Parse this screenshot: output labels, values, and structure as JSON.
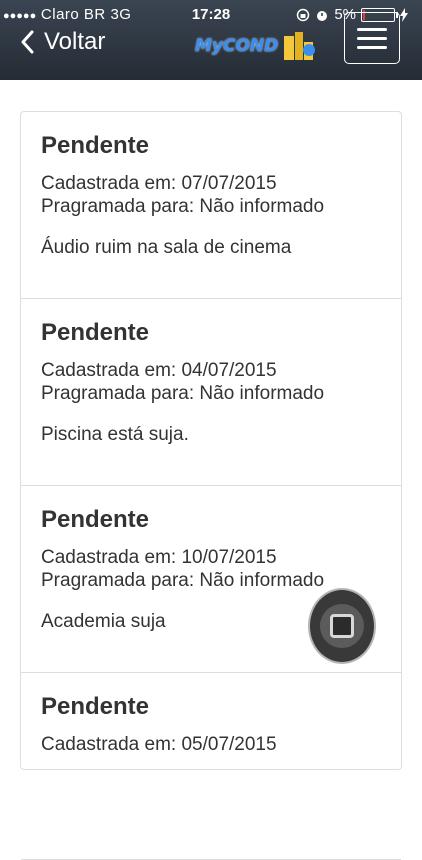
{
  "status_bar": {
    "signal": "●●●●●",
    "carrier": "Claro BR",
    "network": "3G",
    "time": "17:28",
    "battery": "5%"
  },
  "nav": {
    "back_label": "Voltar",
    "logo_text": "MyCOND"
  },
  "occurrences": [
    {
      "status": "Pendente",
      "registered": "Cadastrada em: 07/07/2015",
      "scheduled": "Pragramada para: Não informado",
      "description": "Áudio ruim na sala de cinema"
    },
    {
      "status": "Pendente",
      "registered": "Cadastrada em: 04/07/2015",
      "scheduled": "Pragramada para: Não informado",
      "description": "Piscina está suja."
    },
    {
      "status": "Pendente",
      "registered": "Cadastrada em: 10/07/2015",
      "scheduled": "Pragramada para: Não informado",
      "description": "Academia suja"
    },
    {
      "status": "Pendente",
      "registered": "Cadastrada em: 05/07/2015",
      "scheduled": "",
      "description": ""
    }
  ],
  "colors": {
    "header": "#2c343e",
    "logo": "#3a8ef0",
    "battery_low": "#e23a3a"
  }
}
